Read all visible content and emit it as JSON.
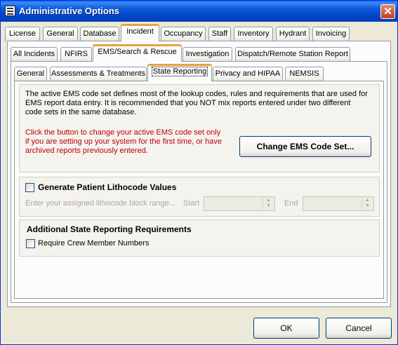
{
  "window": {
    "title": "Administrative Options",
    "close_symbol": "✕"
  },
  "tabs_row1": [
    "License",
    "General",
    "Database",
    "Incident",
    "Occupancy",
    "Staff",
    "Inventory",
    "Hydrant",
    "Invoicing"
  ],
  "tabs_row2": [
    "All Incidents",
    "NFIRS",
    "EMS/Search & Rescue",
    "Investigation",
    "Dispatch/Remote Station Report"
  ],
  "tabs_row3": [
    "General",
    "Assessments & Treatments",
    "State Reporting",
    "Privacy and HIPAA",
    "NEMSIS"
  ],
  "ems": {
    "description": "The active EMS code set defines most of the lookup codes, rules and requirements that are used for EMS report data entry. It is recommended that you NOT mix reports entered under two different code sets in the same database.",
    "warning": "Click the button to change your active EMS code set only if you are setting up your system for the first time, or have archived reports previously entered.",
    "change_button": "Change EMS Code Set..."
  },
  "lithocode": {
    "checkbox_label": "Generate Patient Lithocode Values",
    "checked": false,
    "range_prompt": "Enter your assigned lithocode block range...",
    "start_label": "Start",
    "start_value": "",
    "end_label": "End",
    "end_value": ""
  },
  "additional": {
    "title": "Additional State Reporting Requirements",
    "crew_label": "Require Crew Member Numbers",
    "crew_checked": false
  },
  "footer": {
    "ok": "OK",
    "cancel": "Cancel"
  },
  "colors": {
    "warning_text": "#c00000",
    "disabled_text": "#aca899"
  }
}
